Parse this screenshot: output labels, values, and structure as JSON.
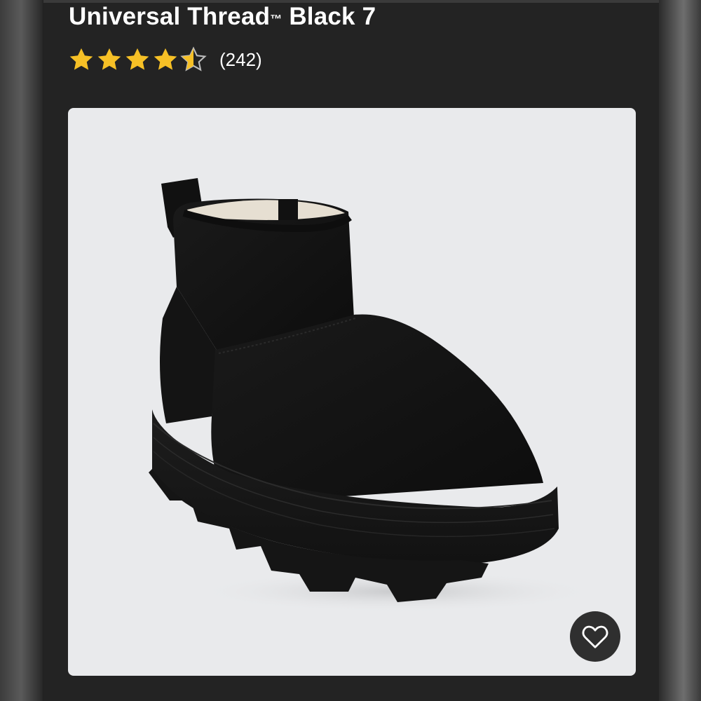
{
  "product": {
    "title": "Universal Thread",
    "trademark": "™",
    "title_suffix": " Black 7",
    "rating": 4.5,
    "rating_max": 5,
    "review_count": "(242)",
    "image_icon": "boot-product-photo"
  },
  "actions": {
    "favorite_icon": "heart-outline-icon"
  },
  "colors": {
    "star": "#f6c026",
    "background": "#232323",
    "card": "#e9eaec",
    "text": "#ffffff"
  }
}
